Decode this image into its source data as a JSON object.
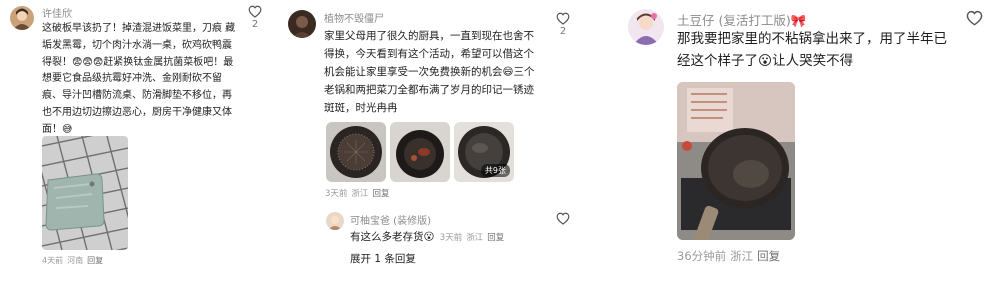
{
  "comments": [
    {
      "user": "许佳欣",
      "text": "这破板早该扔了！掉渣混进饭菜里，刀痕 藏垢发黑霉，切个肉汁水淌一桌，砍鸡砍鸭震得裂！😨😨😨赶紧换钛金属抗菌菜板吧！最想要它食品级抗霉好冲洗、金刚耐砍不留痕、导汁凹槽防流桌、防滑脚垫不移位，再也不用边切边擦边恶心，厨房干净健康又体面！😅",
      "time": "4天前",
      "location": "河南",
      "reply": "回复",
      "likes": "2"
    },
    {
      "user": "植物不毁僵尸",
      "text": "家里父母用了很久的厨具，一直到现在也舍不得换，今天看到有这个活动，希望可以借这个机会能让家里享受一次免费换新的机会😄三个老锅和两把菜刀全都布满了岁月的印记一锈迹斑斑，时光冉冉",
      "image_count_badge": "共9张",
      "time": "3天前",
      "location": "浙江",
      "reply": "回复",
      "likes": "2",
      "sub_reply": {
        "user": "可柚宝爸 (装修版)",
        "text": "有这么多老存货😮",
        "time": "3天前",
        "location": "浙江",
        "reply": "回复"
      },
      "expand_label": "展开 1 条回复"
    },
    {
      "user": "土豆仔 (复活打工版)🎀",
      "text": "那我要把家里的不粘锅拿出来了，用了半年已经这个样子了😮让人哭笑不得",
      "time": "36分钟前",
      "location": "浙江",
      "reply": "回复",
      "likes": ""
    }
  ],
  "colors": {
    "name": "#8b8b8b",
    "meta": "#9a9a9a",
    "text": "#1f1f1f"
  },
  "icons": [
    "heart-icon"
  ]
}
